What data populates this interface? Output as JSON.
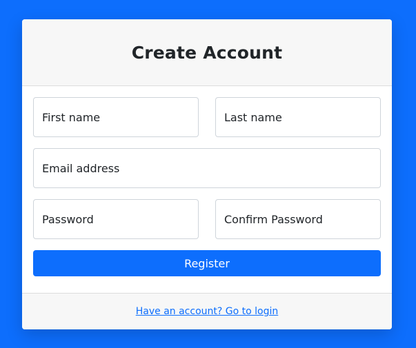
{
  "form": {
    "title": "Create Account",
    "first_name_placeholder": "First name",
    "last_name_placeholder": "Last name",
    "email_placeholder": "Email address",
    "password_placeholder": "Password",
    "confirm_password_placeholder": "Confirm Password",
    "register_label": "Register",
    "login_link": "Have an account? Go to login"
  },
  "colors": {
    "background": "#0d6efd",
    "primary": "#0d6efd",
    "header_bg": "#f7f7f7",
    "border": "#ced4da"
  }
}
